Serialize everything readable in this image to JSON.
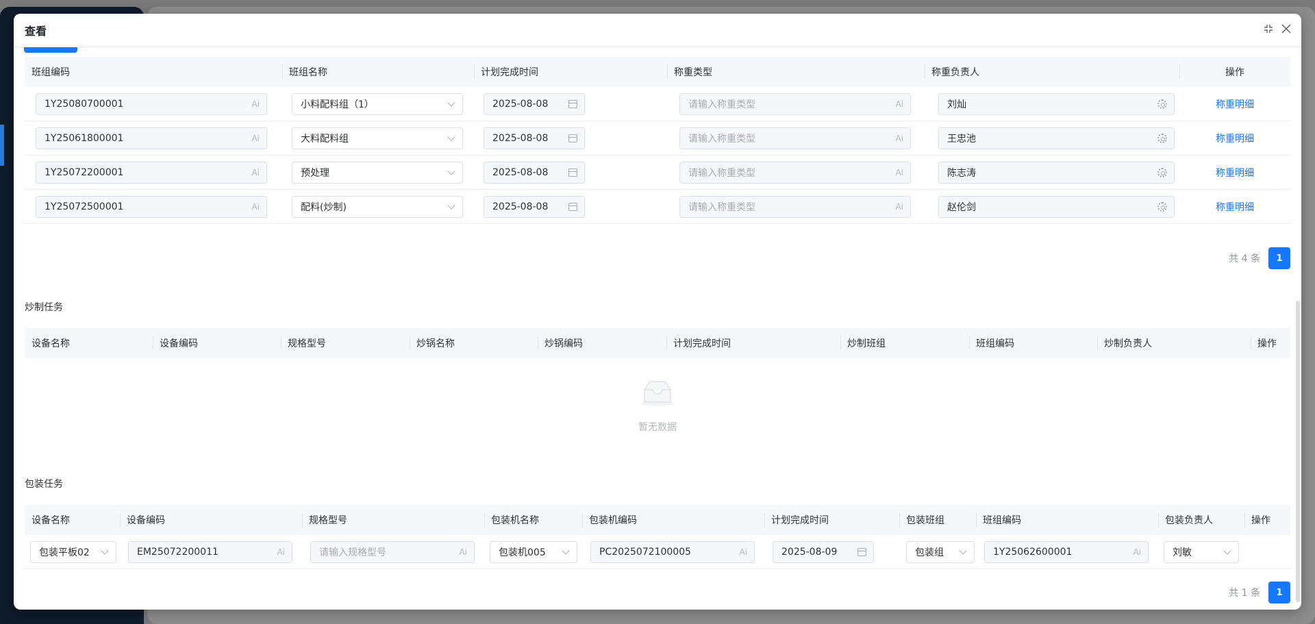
{
  "modal": {
    "title": "查看"
  },
  "weigh_table": {
    "columns": [
      "班组编码",
      "班组名称",
      "计划完成时间",
      "称重类型",
      "称重负责人",
      "操作"
    ],
    "type_placeholder": "请输入称重类型",
    "ai_suffix": "Ai",
    "rows": [
      {
        "code": "1Y25080700001",
        "group": "小料配料组（1）",
        "date": "2025-08-08",
        "person": "刘灿",
        "action": "称重明细"
      },
      {
        "code": "1Y25061800001",
        "group": "大料配料组",
        "date": "2025-08-08",
        "person": "王忠池",
        "action": "称重明细"
      },
      {
        "code": "1Y25072200001",
        "group": "预处理",
        "date": "2025-08-08",
        "person": "陈志涛",
        "action": "称重明细"
      },
      {
        "code": "1Y25072500001",
        "group": "配料(炒制)",
        "date": "2025-08-08",
        "person": "赵伦剑",
        "action": "称重明细"
      }
    ],
    "total": "共 4 条",
    "page": "1"
  },
  "fry_section": {
    "title": "炒制任务",
    "columns": [
      "设备名称",
      "设备编码",
      "规格型号",
      "炒锅名称",
      "炒锅编码",
      "计划完成时间",
      "炒制班组",
      "班组编码",
      "炒制负责人",
      "操作"
    ],
    "empty_text": "暂无数据"
  },
  "pack_section": {
    "title": "包装任务",
    "columns": [
      "设备名称",
      "设备编码",
      "规格型号",
      "包装机名称",
      "包装机编码",
      "计划完成时间",
      "包装班组",
      "班组编码",
      "包装负责人",
      "操作"
    ],
    "spec_placeholder": "请输入规格型号",
    "rows": [
      {
        "device": "包装平板02",
        "device_code": "EM25072200011",
        "machine": "包装机005",
        "machine_code": "PC2025072100005",
        "date": "2025-08-09",
        "team": "包装组",
        "team_code": "1Y25062600001",
        "person": "刘敏"
      }
    ],
    "total": "共 1 条",
    "page": "1"
  }
}
